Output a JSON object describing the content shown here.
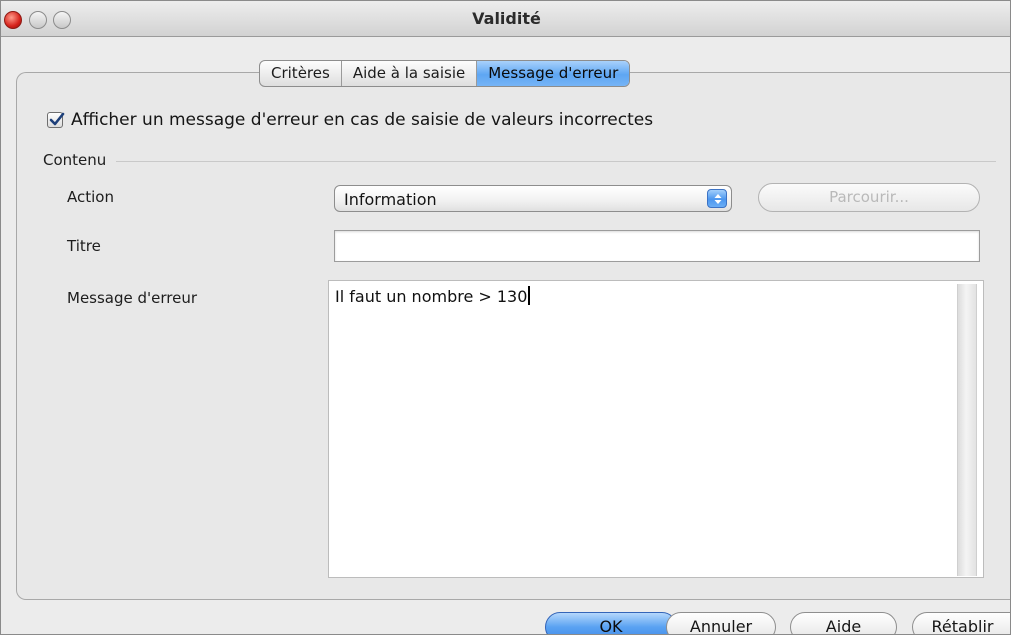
{
  "window": {
    "title": "Validité"
  },
  "tabs": [
    {
      "label": "Critères",
      "active": false
    },
    {
      "label": "Aide à la saisie",
      "active": false
    },
    {
      "label": "Message d'erreur",
      "active": true
    }
  ],
  "show_error": {
    "label": "Afficher un message d'erreur en cas de saisie de valeurs incorrectes",
    "checked": true
  },
  "content": {
    "section_label": "Contenu",
    "action_label": "Action",
    "action_value": "Information",
    "browse_label": "Parcourir...",
    "browse_enabled": false,
    "titre_label": "Titre",
    "titre_value": "",
    "message_label": "Message d'erreur",
    "message_value": "Il faut un nombre > 130"
  },
  "buttons": {
    "ok": "OK",
    "cancel": "Annuler",
    "help": "Aide",
    "reset": "Rétablir"
  },
  "colors": {
    "accent": "#5aa2f2",
    "close_button": "#d6231c"
  }
}
